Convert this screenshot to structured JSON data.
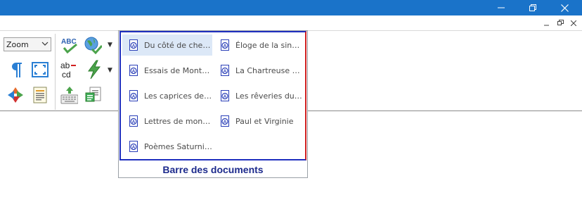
{
  "window": {
    "buttons": {
      "minimize": "minimize-icon",
      "restore": "restore-icon",
      "close": "close-icon"
    },
    "accent_color": "#1a73c9"
  },
  "ribbon": {
    "zoom_select": {
      "value": "Zoom"
    }
  },
  "document_bar": {
    "title": "Barre des documents",
    "items": [
      {
        "label": "Du côté de chez Swann",
        "selected": true
      },
      {
        "label": "Éloge de la sincérité",
        "selected": false
      },
      {
        "label": "Essais de Montaigne",
        "selected": false
      },
      {
        "label": "La Chartreuse de Parme",
        "selected": false
      },
      {
        "label": "Les caprices de Marianne",
        "selected": false
      },
      {
        "label": "Les rêveries du promeneur solitaire",
        "selected": false
      },
      {
        "label": "Lettres de mon moulin",
        "selected": false
      },
      {
        "label": "Paul et Virginie",
        "selected": false
      },
      {
        "label": "Poèmes Saturniens",
        "selected": false
      }
    ],
    "border_color": "#1f2fbf",
    "selected_color": "#dce8f7",
    "title_color": "#1c2a8c"
  }
}
